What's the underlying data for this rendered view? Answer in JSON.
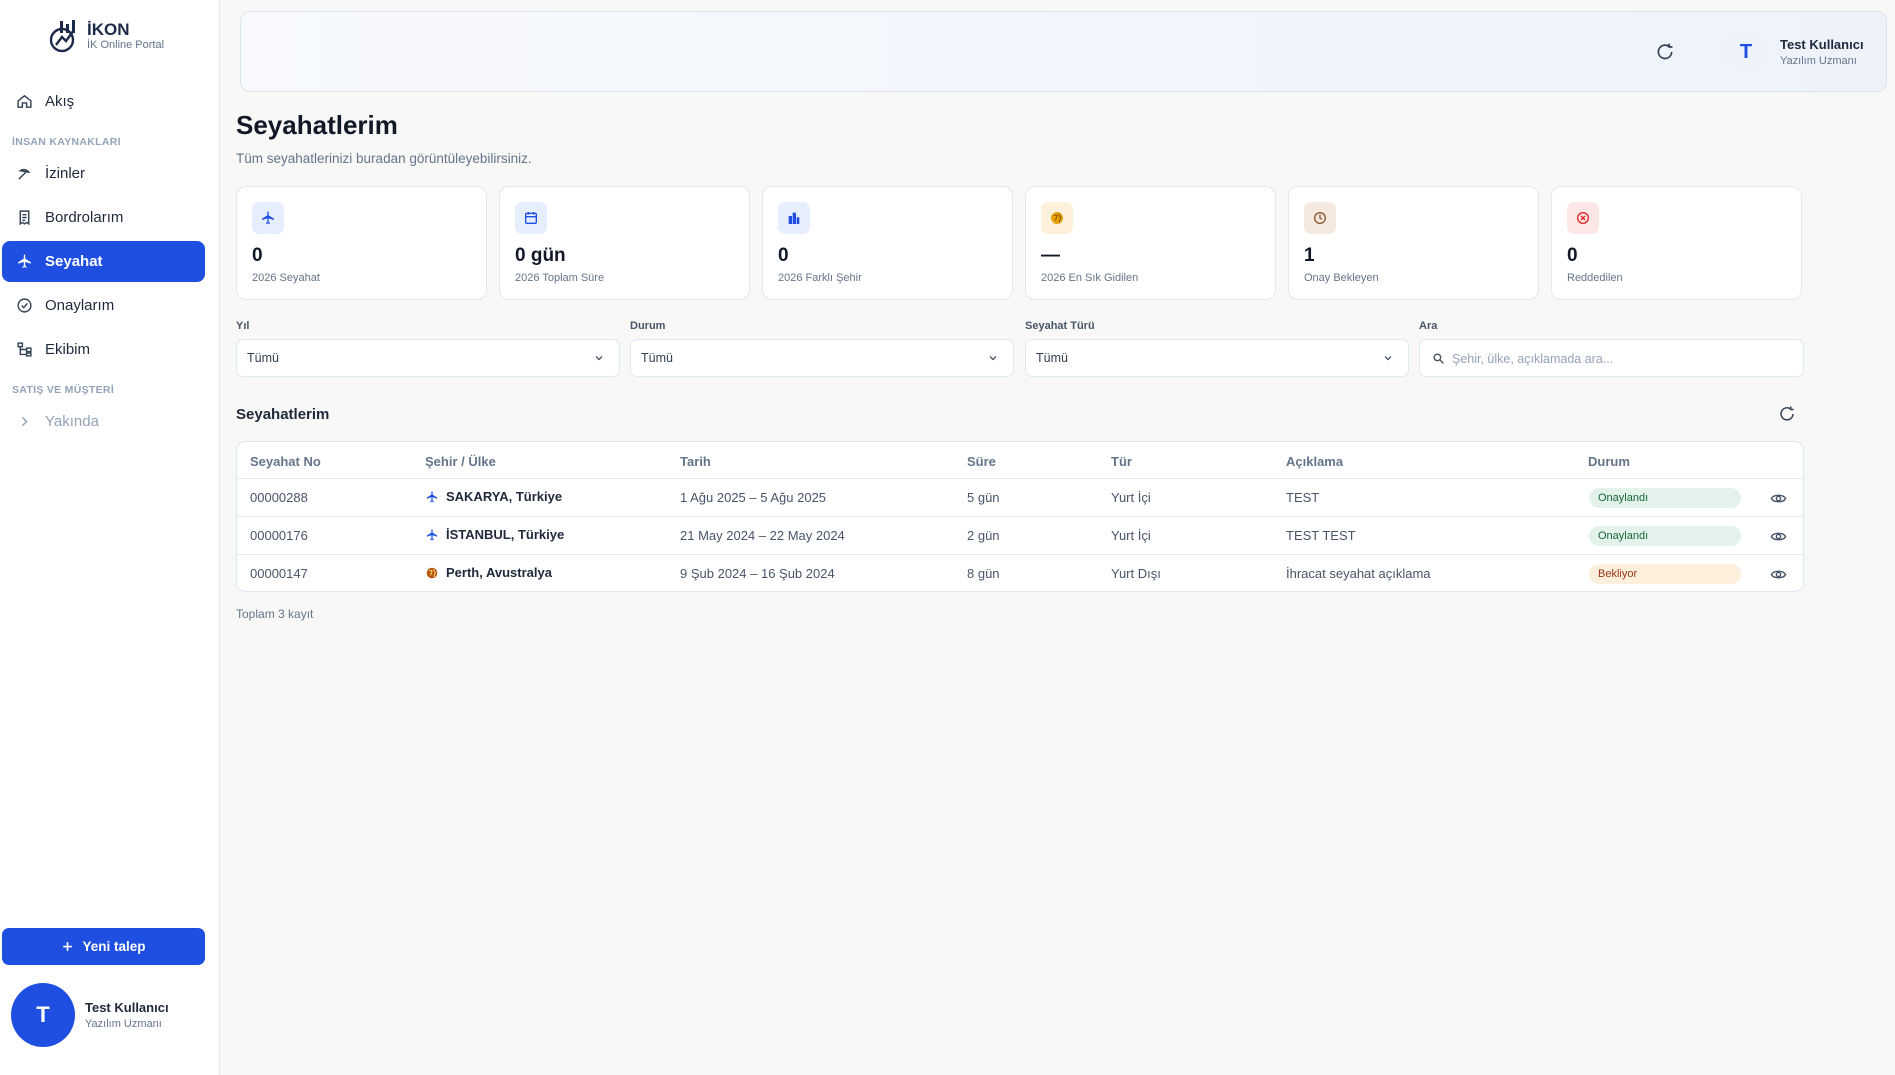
{
  "brand": {
    "title": "İKON",
    "subtitle": "İK Online Portal"
  },
  "sidebar": {
    "items": [
      {
        "label": "Akış",
        "icon": "home-icon"
      },
      {
        "label": "İzinler",
        "icon": "beach-icon"
      },
      {
        "label": "Bordrolarım",
        "icon": "receipt-icon"
      },
      {
        "label": "Seyahat",
        "icon": "plane-icon",
        "active": true
      },
      {
        "label": "Onaylarım",
        "icon": "check-circle-icon"
      },
      {
        "label": "Ekibim",
        "icon": "org-chart-icon"
      },
      {
        "label": "Yakında",
        "icon": "chevron-right-icon"
      }
    ],
    "sections": [
      "İNSAN KAYNAKLARI",
      "SATIŞ VE MÜŞTERİ"
    ],
    "new_request": "Yeni talep"
  },
  "user": {
    "initial": "T",
    "name": "Test Kullanıcı",
    "role": "Yazılım Uzmanı"
  },
  "page": {
    "title": "Seyahatlerim",
    "subtitle": "Tüm seyahatlerinizi buradan görüntüleyebilirsiniz."
  },
  "stats": [
    {
      "value": "0",
      "label": "2026 Seyahat",
      "icon": "plane-icon",
      "color": "#1f4fe0"
    },
    {
      "value": "0 gün",
      "label": "2026 Toplam Süre",
      "icon": "calendar-icon",
      "color": "#1f4fe0"
    },
    {
      "value": "0",
      "label": "2026 Farklı Şehir",
      "icon": "buildings-icon",
      "color": "#1f4fe0"
    },
    {
      "value": "—",
      "label": "2026 En Sık Gidilen",
      "icon": "globe-icon",
      "color": "#e8a20c"
    },
    {
      "value": "1",
      "label": "Onay Bekleyen",
      "icon": "clock-icon",
      "color": "#8a5a2b"
    },
    {
      "value": "0",
      "label": "Reddedilen",
      "icon": "x-circle-icon",
      "color": "#dc2626"
    }
  ],
  "filters": {
    "year": {
      "label": "Yıl",
      "value": "Tümü"
    },
    "status": {
      "label": "Durum",
      "value": "Tümü"
    },
    "type": {
      "label": "Seyahat Türü",
      "value": "Tümü"
    },
    "search": {
      "label": "Ara",
      "placeholder": "Şehir, ülke, açıklamada ara..."
    }
  },
  "table": {
    "title": "Seyahatlerim",
    "columns": [
      "Seyahat No",
      "Şehir / Ülke",
      "Tarih",
      "Süre",
      "Tür",
      "Açıklama",
      "Durum"
    ],
    "rows": [
      {
        "no": "00000288",
        "city": "SAKARYA, Türkiye",
        "icon": "plane-icon",
        "date": "1 Ağu 2025 – 5 Ağu 2025",
        "duration": "5 gün",
        "type": "Yurt İçi",
        "desc": "TEST",
        "status": "Onaylandı"
      },
      {
        "no": "00000176",
        "city": "İSTANBUL, Türkiye",
        "icon": "plane-icon",
        "date": "21 May 2024 – 22 May 2024",
        "duration": "2 gün",
        "type": "Yurt İçi",
        "desc": "TEST TEST",
        "status": "Onaylandı"
      },
      {
        "no": "00000147",
        "city": "Perth, Avustralya",
        "icon": "globe-icon",
        "date": "9 Şub 2024 – 16 Şub 2024",
        "duration": "8 gün",
        "type": "Yurt Dışı",
        "desc": "İhracat seyahat açıklama",
        "status": "Bekliyor"
      }
    ],
    "total": "Toplam 3 kayıt"
  },
  "colors": {
    "accent": "#1f4fe0",
    "approved_bg": "#e3f3ec",
    "pending_bg": "#fcefdc"
  }
}
